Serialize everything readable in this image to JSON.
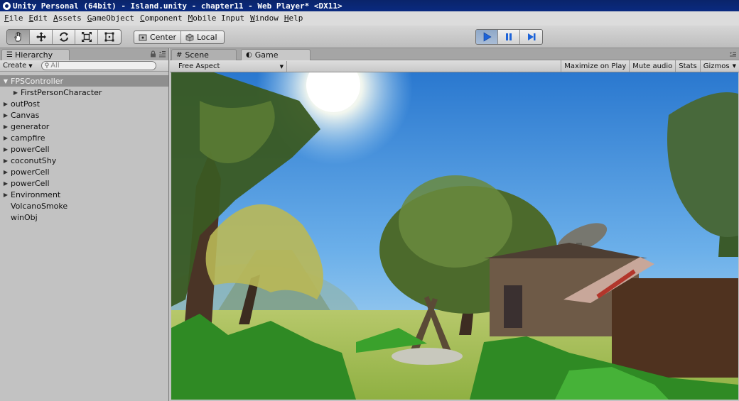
{
  "window": {
    "title": "Unity Personal (64bit) - Island.unity - chapter11 - Web Player* <DX11>"
  },
  "menu": {
    "items": [
      "File",
      "Edit",
      "Assets",
      "GameObject",
      "Component",
      "Mobile Input",
      "Window",
      "Help"
    ]
  },
  "toolbar": {
    "transform_tools": [
      "hand-tool",
      "move-tool",
      "rotate-tool",
      "scale-tool",
      "rect-tool"
    ],
    "active_tool": "hand-tool",
    "pivot_label": "Center",
    "space_label": "Local",
    "playback_active": "play"
  },
  "hierarchy": {
    "tab_label": "Hierarchy",
    "create_label": "Create",
    "search_placeholder": "All",
    "items": [
      {
        "label": "FPSController",
        "expanded": true,
        "selected": true,
        "has_children": true
      },
      {
        "label": "FirstPersonCharacter",
        "child": true,
        "has_children": true
      },
      {
        "label": "outPost",
        "has_children": true
      },
      {
        "label": "Canvas",
        "has_children": true
      },
      {
        "label": "generator",
        "has_children": true
      },
      {
        "label": "campfire",
        "has_children": true
      },
      {
        "label": "powerCell",
        "has_children": true
      },
      {
        "label": "coconutShy",
        "has_children": true
      },
      {
        "label": "powerCell",
        "has_children": true
      },
      {
        "label": "powerCell",
        "has_children": true
      },
      {
        "label": "Environment",
        "has_children": true
      },
      {
        "label": "VolcanoSmoke",
        "has_children": false
      },
      {
        "label": "winObj",
        "has_children": false
      }
    ]
  },
  "game_view": {
    "tabs": [
      "Scene",
      "Game"
    ],
    "active_tab": "Game",
    "aspect_label": "Free Aspect",
    "toggles": [
      "Maximize on Play",
      "Mute audio",
      "Stats",
      "Gizmos"
    ]
  },
  "colors": {
    "selection": "#8f8f8f",
    "play_active": "#2a6fd6",
    "titlebar": "#0a246a"
  }
}
